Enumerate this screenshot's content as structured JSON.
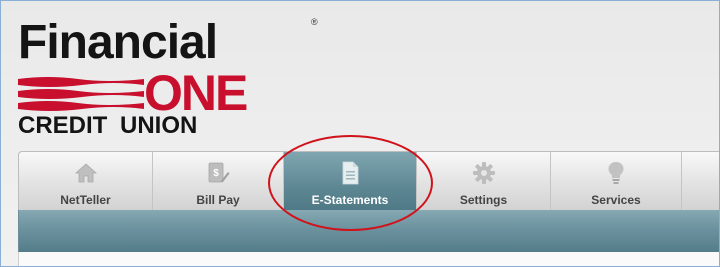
{
  "logo": {
    "line1": "Financial",
    "registered": "®",
    "line2": "ONE",
    "line3": "CREDIT UNION"
  },
  "nav": {
    "tabs": [
      {
        "label": "NetTeller",
        "icon": "house-icon",
        "active": false
      },
      {
        "label": "Bill Pay",
        "icon": "bill-pay-icon",
        "active": false
      },
      {
        "label": "E-Statements",
        "icon": "document-icon",
        "active": true
      },
      {
        "label": "Settings",
        "icon": "gear-icon",
        "active": false
      },
      {
        "label": "Services",
        "icon": "lightbulb-icon",
        "active": false
      }
    ]
  },
  "colors": {
    "brand_red": "#c8102e",
    "active_tab": "#5e8794",
    "annotation": "#d0121b"
  }
}
